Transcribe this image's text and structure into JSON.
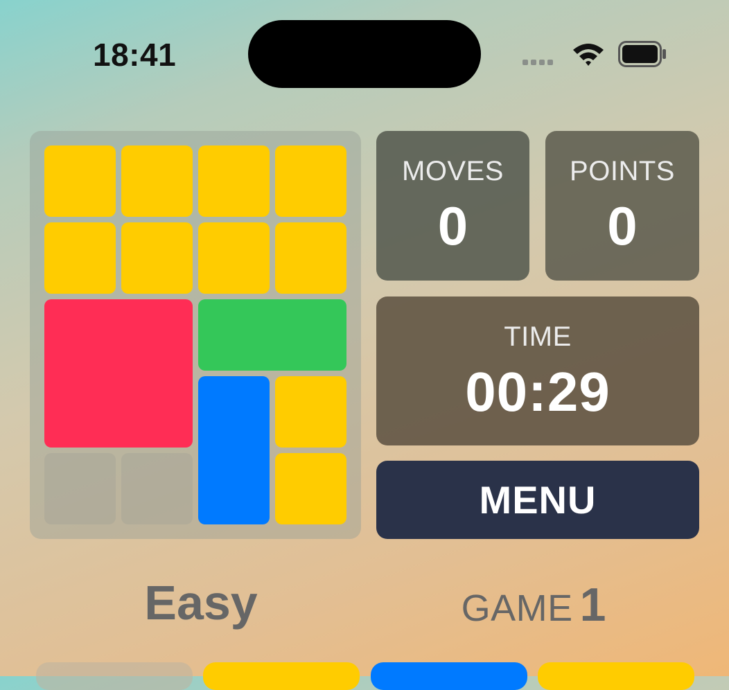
{
  "status_bar": {
    "time": "18:41"
  },
  "board": {
    "colors": {
      "yellow": "#ffcc00",
      "red": "#ff2d55",
      "green": "#34c759",
      "blue": "#007aff"
    }
  },
  "stats": {
    "moves_label": "MOVES",
    "moves_value": "0",
    "points_label": "POINTS",
    "points_value": "0",
    "time_label": "TIME",
    "time_value": "00:29"
  },
  "menu": {
    "label": "MENU"
  },
  "difficulty": "Easy",
  "game": {
    "label": "GAME",
    "number": "1"
  }
}
